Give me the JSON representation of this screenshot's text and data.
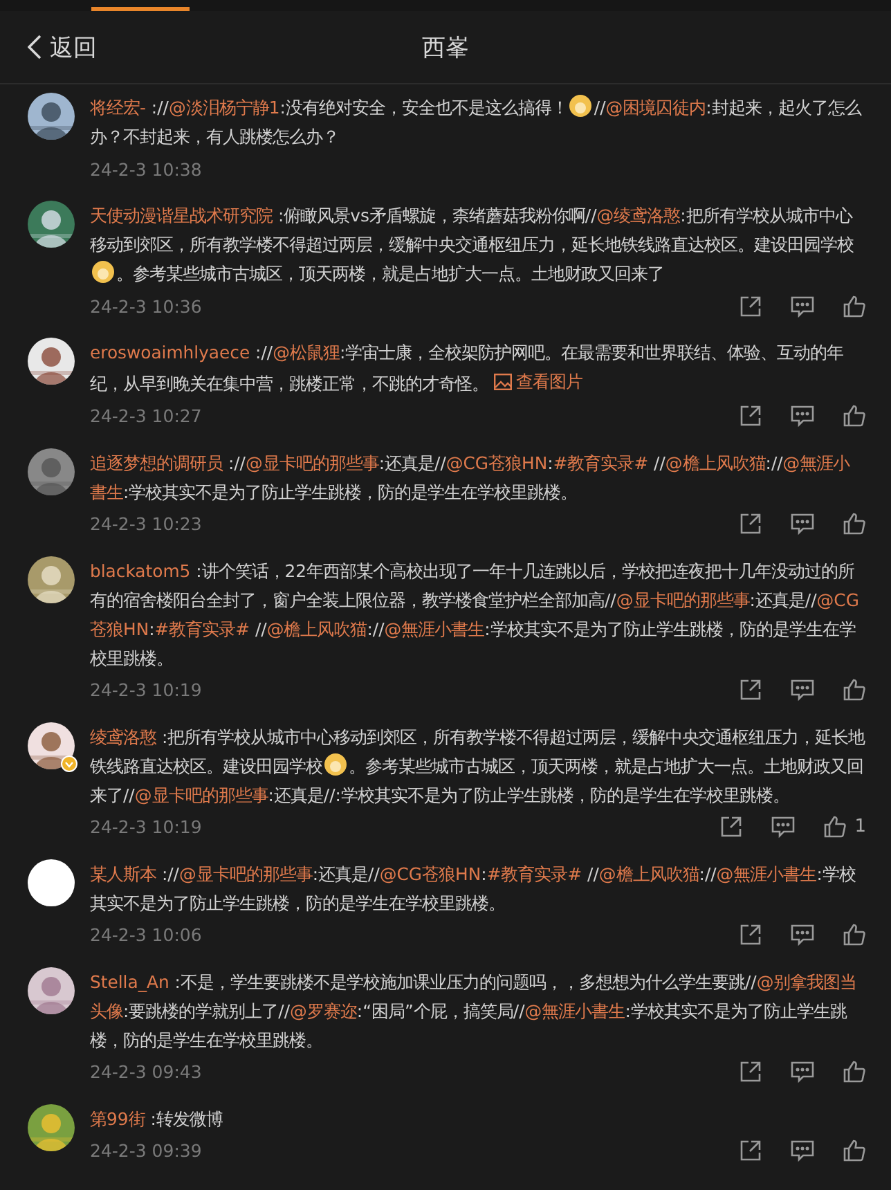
{
  "header": {
    "back_label": "返回",
    "title": "西峯"
  },
  "comments": [
    {
      "user": "将经宏-",
      "verified": false,
      "show_actions": false,
      "time": "24-2-3 10:38",
      "segments": [
        {
          "kind": "text",
          "text": " ://"
        },
        {
          "kind": "mention",
          "text": "@淡泪杨宁静1"
        },
        {
          "kind": "text",
          "text": ":没有绝对安全，安全也不是这么搞得！"
        },
        {
          "kind": "emoji"
        },
        {
          "kind": "text",
          "text": "//"
        },
        {
          "kind": "mention",
          "text": "@困境囚徒内"
        },
        {
          "kind": "text",
          "text": ":封起来，起火了怎么办？不封起来，有人跳楼怎么办？"
        }
      ]
    },
    {
      "user": "天使动漫谐星战术研究院",
      "verified": false,
      "show_actions": true,
      "time": "24-2-3 10:36",
      "segments": [
        {
          "kind": "text",
          "text": " :俯瞰风景vs矛盾螺旋，柰绪蘑菇我粉你啊//"
        },
        {
          "kind": "mention",
          "text": "@绫鸢洛憨"
        },
        {
          "kind": "text",
          "text": ":把所有学校从城市中心移动到郊区，所有教学楼不得超过两层，缓解中央交通枢纽压力，延长地铁线路直达校区。建设田园学校"
        },
        {
          "kind": "emoji"
        },
        {
          "kind": "text",
          "text": "。参考某些城市古城区，顶天两楼，就是占地扩大一点。土地财政又回来了"
        }
      ]
    },
    {
      "user": "eroswoaimhlyaece",
      "verified": false,
      "show_actions": true,
      "time": "24-2-3 10:27",
      "segments": [
        {
          "kind": "text",
          "text": " ://"
        },
        {
          "kind": "mention",
          "text": "@松鼠狸"
        },
        {
          "kind": "text",
          "text": ":学宙士康，全校架防护网吧。在最需要和世界联结、体验、互动的年纪，从早到晚关在集中营，跳楼正常，不跳的才奇怪。 "
        },
        {
          "kind": "image_link",
          "text": "查看图片"
        }
      ]
    },
    {
      "user": "追逐梦想的调研员",
      "verified": false,
      "show_actions": true,
      "time": "24-2-3 10:23",
      "segments": [
        {
          "kind": "text",
          "text": " ://"
        },
        {
          "kind": "mention",
          "text": "@显卡吧的那些事"
        },
        {
          "kind": "text",
          "text": ":还真是//"
        },
        {
          "kind": "mention",
          "text": "@CG苍狼HN"
        },
        {
          "kind": "text",
          "text": ":"
        },
        {
          "kind": "mention",
          "text": "#教育实录#"
        },
        {
          "kind": "text",
          "text": " //"
        },
        {
          "kind": "mention",
          "text": "@檐上风吹猫"
        },
        {
          "kind": "text",
          "text": "://"
        },
        {
          "kind": "mention",
          "text": "@無涯小書生"
        },
        {
          "kind": "text",
          "text": ":学校其实不是为了防止学生跳楼，防的是学生在学校里跳楼。"
        }
      ]
    },
    {
      "user": "blackatom5",
      "verified": false,
      "show_actions": true,
      "time": "24-2-3 10:19",
      "segments": [
        {
          "kind": "text",
          "text": " :讲个笑话，22年西部某个高校出现了一年十几连跳以后，学校把连夜把十几年没动过的所有的宿舍楼阳台全封了，窗户全装上限位器，教学楼食堂护栏全部加高//"
        },
        {
          "kind": "mention",
          "text": "@显卡吧的那些事"
        },
        {
          "kind": "text",
          "text": ":还真是//"
        },
        {
          "kind": "mention",
          "text": "@CG苍狼HN"
        },
        {
          "kind": "text",
          "text": ":"
        },
        {
          "kind": "mention",
          "text": "#教育实录#"
        },
        {
          "kind": "text",
          "text": " //"
        },
        {
          "kind": "mention",
          "text": "@檐上风吹猫"
        },
        {
          "kind": "text",
          "text": "://"
        },
        {
          "kind": "mention",
          "text": "@無涯小書生"
        },
        {
          "kind": "text",
          "text": ":学校其实不是为了防止学生跳楼，防的是学生在学校里跳楼。"
        }
      ]
    },
    {
      "user": "绫鸢洛憨",
      "verified": true,
      "show_actions": true,
      "time": "24-2-3 10:19",
      "likes": "1",
      "segments": [
        {
          "kind": "text",
          "text": " :把所有学校从城市中心移动到郊区，所有教学楼不得超过两层，缓解中央交通枢纽压力，延长地铁线路直达校区。建设田园学校"
        },
        {
          "kind": "emoji"
        },
        {
          "kind": "text",
          "text": "。参考某些城市古城区，顶天两楼，就是占地扩大一点。土地财政又回来了//"
        },
        {
          "kind": "mention",
          "text": "@显卡吧的那些事"
        },
        {
          "kind": "text",
          "text": ":还真是//:学校其实不是为了防止学生跳楼，防的是学生在学校里跳楼。"
        }
      ]
    },
    {
      "user": "某人斯本",
      "verified": false,
      "show_actions": true,
      "time": "24-2-3 10:06",
      "segments": [
        {
          "kind": "text",
          "text": " ://"
        },
        {
          "kind": "mention",
          "text": "@显卡吧的那些事"
        },
        {
          "kind": "text",
          "text": ":还真是//"
        },
        {
          "kind": "mention",
          "text": "@CG苍狼HN"
        },
        {
          "kind": "text",
          "text": ":"
        },
        {
          "kind": "mention",
          "text": "#教育实录#"
        },
        {
          "kind": "text",
          "text": " //"
        },
        {
          "kind": "mention",
          "text": "@檐上风吹猫"
        },
        {
          "kind": "text",
          "text": "://"
        },
        {
          "kind": "mention",
          "text": "@無涯小書生"
        },
        {
          "kind": "text",
          "text": ":学校其实不是为了防止学生跳楼，防的是学生在学校里跳楼。"
        }
      ]
    },
    {
      "user": "Stella_An",
      "verified": false,
      "show_actions": true,
      "time": "24-2-3 09:43",
      "segments": [
        {
          "kind": "text",
          "text": " :不是，学生要跳楼不是学校施加课业压力的问题吗，，多想想为什么学生要跳//"
        },
        {
          "kind": "mention",
          "text": "@别拿我图当头像"
        },
        {
          "kind": "text",
          "text": ":要跳楼的学就别上了//"
        },
        {
          "kind": "mention",
          "text": "@罗赛迩"
        },
        {
          "kind": "text",
          "text": ":“困局”个屁，搞笑局//"
        },
        {
          "kind": "mention",
          "text": "@無涯小書生"
        },
        {
          "kind": "text",
          "text": ":学校其实不是为了防止学生跳楼，防的是学生在学校里跳楼。"
        }
      ]
    },
    {
      "user": "第99街",
      "verified": false,
      "show_actions": true,
      "time": "24-2-3 09:39",
      "segments": [
        {
          "kind": "text",
          "text": " :转发微博"
        }
      ]
    }
  ]
}
